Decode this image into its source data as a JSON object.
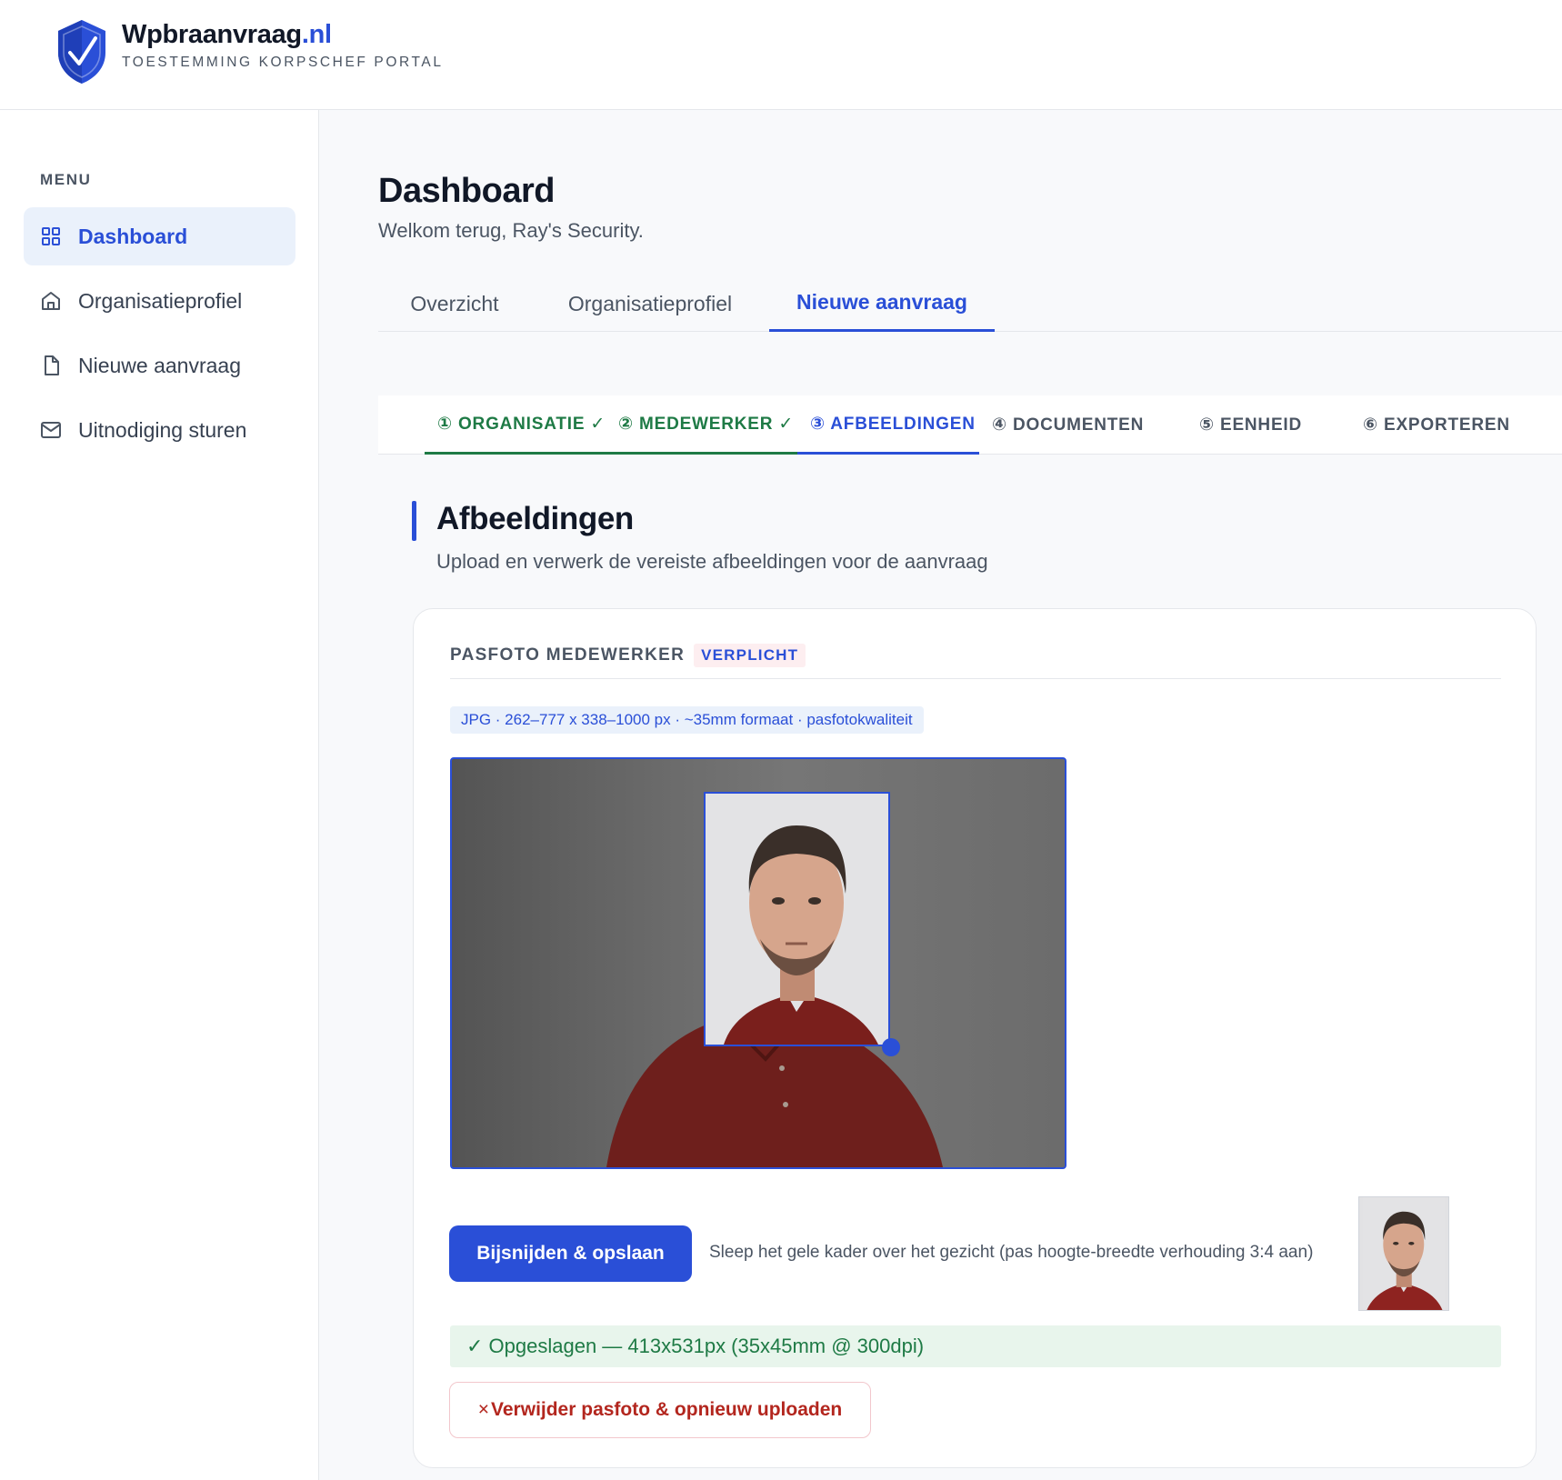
{
  "brand": {
    "name": "Wpbraanvraag",
    "tld": ".nl",
    "subtitle": "TOESTEMMING KORPSCHEF PORTAL",
    "logo_icon": "shield-check-icon",
    "accent": "#2a4fd7"
  },
  "sidebar": {
    "menu_label": "MENU",
    "items": [
      {
        "label": "Dashboard",
        "icon": "grid-icon",
        "active": true
      },
      {
        "label": "Organisatieprofiel",
        "icon": "home-icon",
        "active": false
      },
      {
        "label": "Nieuwe aanvraag",
        "icon": "file-icon",
        "active": false
      },
      {
        "label": "Uitnodiging sturen",
        "icon": "mail-icon",
        "active": false
      }
    ]
  },
  "main": {
    "title": "Dashboard",
    "subtitle": "Welkom terug, Ray's Security.",
    "tabs": [
      {
        "label": "Overzicht",
        "active": false
      },
      {
        "label": "Organisatieprofiel",
        "active": false
      },
      {
        "label": "Nieuwe aanvraag",
        "active": true
      }
    ],
    "steps": [
      {
        "label": "① ORGANISATIE ✓",
        "state": "done"
      },
      {
        "label": "② MEDEWERKER ✓",
        "state": "done"
      },
      {
        "label": "③ AFBEELDINGEN",
        "state": "current"
      },
      {
        "label": "④ DOCUMENTEN",
        "state": "pending"
      },
      {
        "label": "⑤ EENHEID",
        "state": "pending"
      },
      {
        "label": "⑥ EXPORTEREN",
        "state": "pending"
      }
    ],
    "section": {
      "title": "Afbeeldingen",
      "subtitle": "Upload en verwerk de vereiste afbeeldingen voor de aanvraag"
    },
    "card": {
      "title": "PASFOTO MEDEWERKER",
      "badge": "VERPLICHT",
      "spec": "JPG · 262–777 x 338–1000 px · ~35mm formaat · pasfotokwaliteit",
      "crop_button": "Bijsnijden & opslaan",
      "hint": "Sleep het gele kader over het gezicht (pas hoogte-breedte verhouding 3:4 aan)",
      "saved": "✓ Opgeslagen — 413x531px (35x45mm @ 300dpi)",
      "delete_icon": "×",
      "delete_button": "Verwijder pasfoto & opnieuw uploaden",
      "success_color": "#1e7a45",
      "danger_color": "#b3261e"
    }
  }
}
